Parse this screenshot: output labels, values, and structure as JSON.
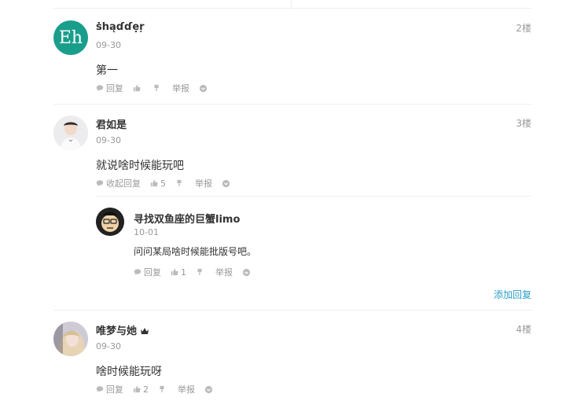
{
  "comments": [
    {
      "avatar_text": "Eh",
      "name": "ṡhąɗɗẹŗ",
      "date": "09-30",
      "floor": "2楼",
      "content": "第一",
      "actions": {
        "reply": "回复",
        "like_count": "",
        "report": "举报"
      }
    },
    {
      "name": "君如是",
      "date": "09-30",
      "floor": "3楼",
      "content": "就说啥时候能玩吧",
      "actions": {
        "reply": "收起回复",
        "like_count": "5",
        "report": "举报"
      },
      "replies": [
        {
          "name": "寻找双鱼座的巨蟹limo",
          "date": "10-01",
          "content": "问问某局啥时候能批版号吧。",
          "actions": {
            "reply": "回复",
            "like_count": "1",
            "report": "举报"
          }
        }
      ],
      "add_reply": "添加回复"
    },
    {
      "name": "唯梦与她",
      "badge_icon": "crown-icon",
      "date": "09-30",
      "floor": "4楼",
      "content": "啥时候能玩呀",
      "actions": {
        "reply": "回复",
        "like_count": "2",
        "report": "举报"
      }
    }
  ],
  "colors": {
    "avatar_teal": "#1a9e8c",
    "link_blue": "#2aa0c8",
    "muted": "#999999"
  }
}
